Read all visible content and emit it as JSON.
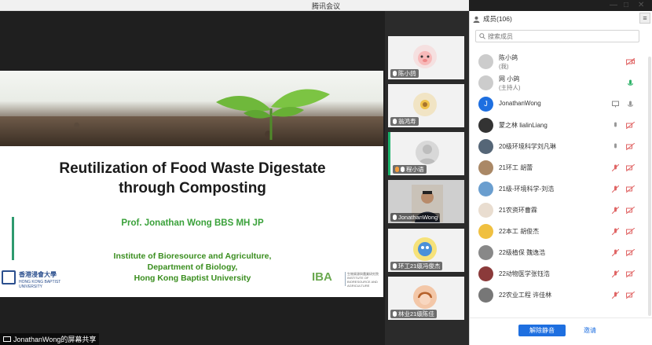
{
  "window": {
    "title": "腾讯会议"
  },
  "slide": {
    "title_line1": "Reutilization of Food Waste Digestate",
    "title_line2": "through Composting",
    "author": "Prof. Jonathan Wong BBS MH JP",
    "inst_line1": "Institute of Bioresource and Agriculture,",
    "inst_line2": "Department of Biology,",
    "inst_line3": "Hong Kong Baptist University",
    "hkbu_zh": "香港浸會大學",
    "hkbu_en": "HONG KONG BAPTIST UNIVERSITY",
    "iba_mark": "IBA",
    "iba_text": "生物資源與農業研究院 INSTITUTE OF BIORESOURCE AND AGRICULTURE"
  },
  "share_bar": {
    "text": "JonathanWong的屏幕共享"
  },
  "thumbnails": [
    {
      "label": "陈小鸽"
    },
    {
      "label": "翁鸿寿"
    },
    {
      "label": "程小语"
    },
    {
      "label": "JonathanWong"
    },
    {
      "label": "环工21级冯俊杰"
    },
    {
      "label": "林业21级陈佳"
    }
  ],
  "panel": {
    "title": "成员(106)",
    "menu_icon": "≡",
    "search_placeholder": "搜索成员",
    "members": [
      {
        "name": "陈小鸽",
        "sub": "(我)",
        "avatar_color": "#f3d6d6"
      },
      {
        "name": "网 小鸽",
        "sub": "(主持人)",
        "avatar_color": "#e4e4e4"
      },
      {
        "name": "JonathanWong",
        "sub": "",
        "avatar_color": "#1e6fe0",
        "avatar_text": "J"
      },
      {
        "name": "蒙之林 lialinLiang",
        "sub": "",
        "avatar_color": "#333333"
      },
      {
        "name": "20级环境科学刘凡琳",
        "sub": "",
        "avatar_color": "#556677"
      },
      {
        "name": "21环工 胡蕾",
        "sub": "",
        "avatar_color": "#aa8866"
      },
      {
        "name": "21级-环境科学-刘浩",
        "sub": "",
        "avatar_color": "#6a9ecf"
      },
      {
        "name": "21农资环曹霖",
        "sub": "",
        "avatar_color": "#e9ddd0"
      },
      {
        "name": "22本工 胡俊杰",
        "sub": "",
        "avatar_color": "#f0c040"
      },
      {
        "name": "22级植保 魏逸浩",
        "sub": "",
        "avatar_color": "#888888"
      },
      {
        "name": "22动物医学张钰浩",
        "sub": "",
        "avatar_color": "#8b3a3a"
      },
      {
        "name": "22农业工程 许佳林",
        "sub": "",
        "avatar_color": "#777777"
      }
    ],
    "primary_button": "解除静音",
    "link_button": "邀请"
  },
  "colors": {
    "accent": "#1e6fe0",
    "slide_green": "#3aa13a",
    "muted_red": "#e06666",
    "active_green": "#1bb36b"
  }
}
